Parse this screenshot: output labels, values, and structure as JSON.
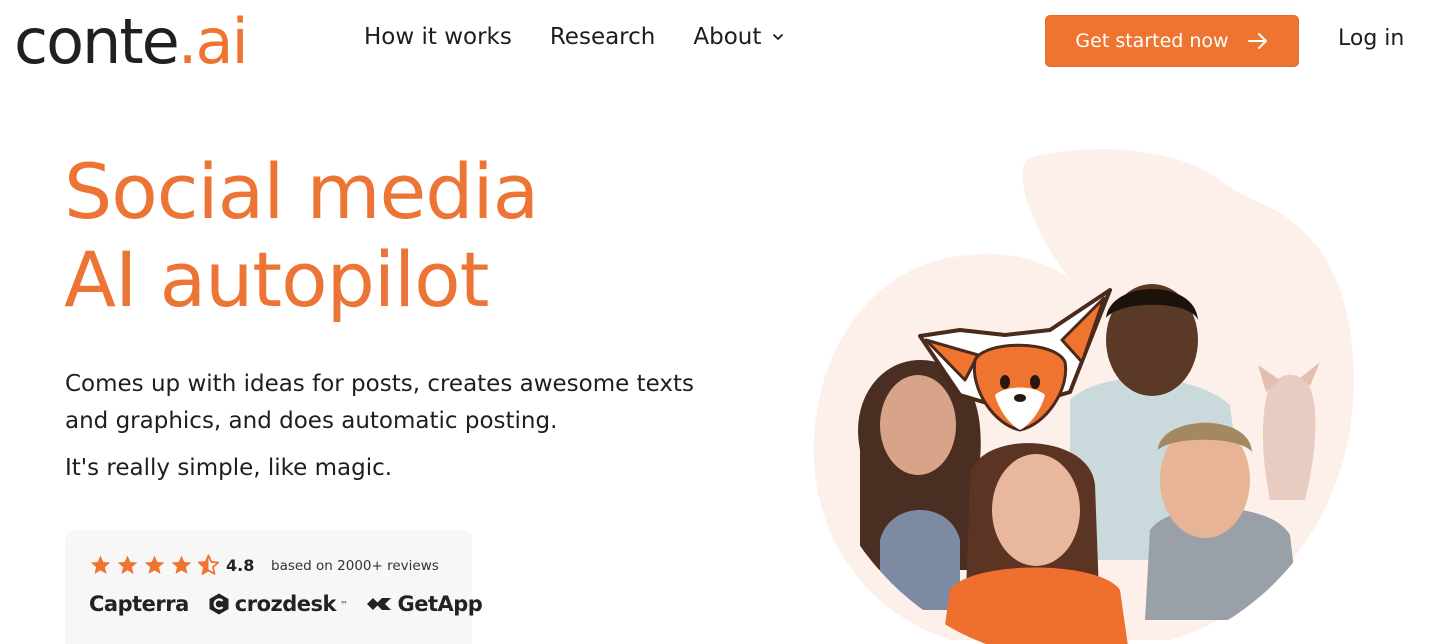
{
  "brand": {
    "name_main": "conte",
    "name_accent": ".ai"
  },
  "nav": {
    "items": [
      {
        "label": "How it works"
      },
      {
        "label": "Research"
      },
      {
        "label": "About",
        "has_dropdown": true
      }
    ]
  },
  "header": {
    "cta_label": "Get started now",
    "login_label": "Log in"
  },
  "hero": {
    "headline_line1": "Social media",
    "headline_line2": "AI autopilot",
    "subtext": "Comes up with ideas for posts, creates awesome texts and graphics, and does automatic posting.",
    "subtext2": "It's really simple, like magic."
  },
  "reviews": {
    "stars": 4.5,
    "rating": "4.8",
    "based_on": "based on 2000+ reviews",
    "brands": [
      "Capterra",
      "crozdesk",
      "GetApp"
    ]
  },
  "colors": {
    "accent": "#ee7430",
    "text": "#1e1e1e",
    "card_bg": "#f7f7f7",
    "blob": "#fdf0ea"
  },
  "icons": [
    "chevron-down-icon",
    "arrow-right-icon",
    "star-icon",
    "crozdesk-logo-icon",
    "getapp-logo-icon"
  ]
}
